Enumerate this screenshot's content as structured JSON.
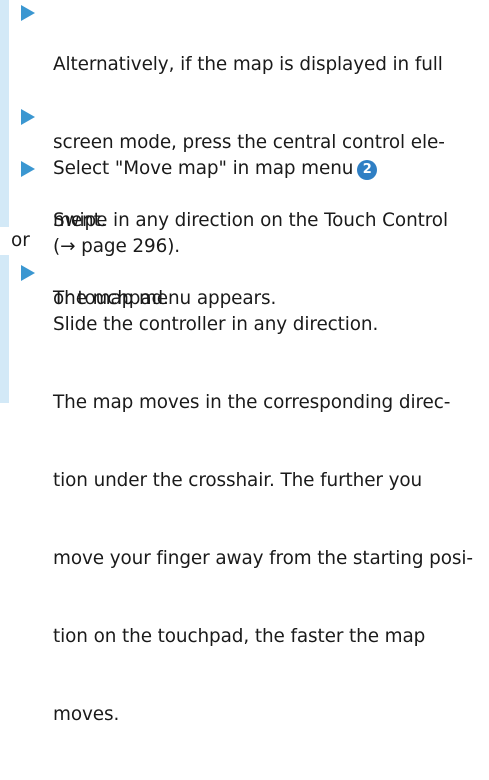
{
  "steps": [
    {
      "lines": [
        "Alternatively, if the map is displayed in full",
        "screen mode, press the central control ele-",
        "ment.",
        "The map menu appears."
      ]
    },
    {
      "line1_text": "Select \"Move map\" in map menu",
      "badge": "2",
      "line2": "(→ page 296)."
    },
    {
      "lines": [
        "Swipe in any direction on the Touch Control",
        "or touchpad."
      ]
    },
    {
      "lines": [
        "Slide the controller in any direction.",
        "The map moves in the corresponding direc-",
        "tion under the crosshair. The further you",
        "move your finger away from the starting posi-",
        "tion on the touchpad, the faster the map",
        "moves."
      ]
    }
  ],
  "or_label": "or",
  "colors": {
    "arrow": "#3b97d1",
    "sidebar_band": "#d3e9f7",
    "badge": "#2f7fc4"
  }
}
